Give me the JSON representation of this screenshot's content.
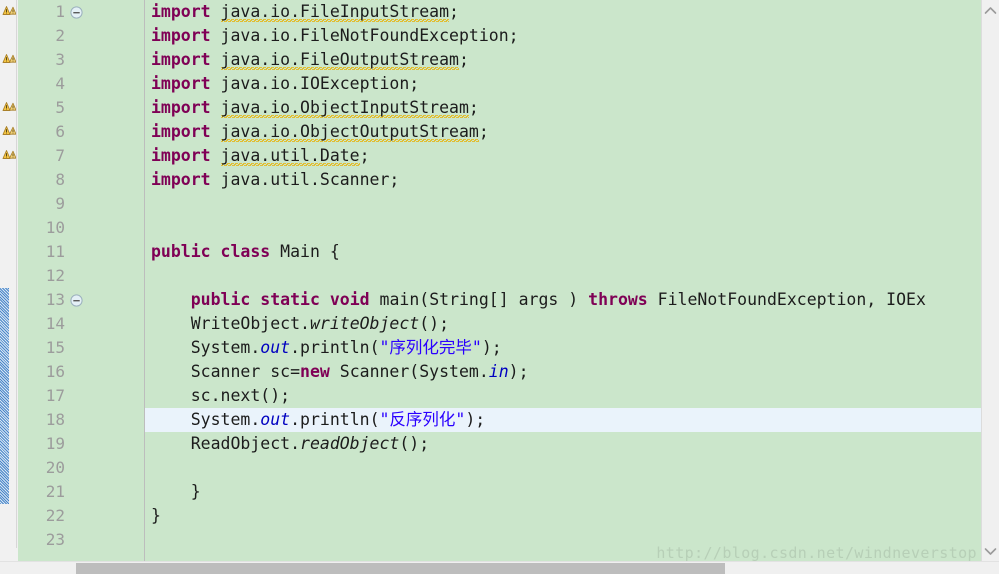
{
  "editor": {
    "language": "java",
    "theme": {
      "background": "#cbe6cb",
      "gutter_background": "#cbe6cb",
      "annotation_ruler_background": "#f1f1f1",
      "line_number_color": "#9c9c9c",
      "keyword_color": "#7f0055",
      "string_color": "#2a00ff",
      "field_color": "#0000c0",
      "text_color": "#1c1c1c",
      "current_line_highlight": "#eaf3fb",
      "warning_squiggle_color": "#e8b000",
      "change_bar_color": "#4a86c8",
      "scrollbar_thumb": "#bdbdbd"
    },
    "current_line": 18,
    "change_bar_start_line": 13,
    "change_bar_end_line": 21,
    "fold_marker_lines": [
      1,
      13
    ],
    "warning_icon_lines": [
      1,
      3,
      5,
      6,
      7
    ],
    "lines": [
      {
        "n": 1,
        "tokens": [
          {
            "t": "import",
            "c": "kw"
          },
          {
            "t": " ",
            "c": "plain"
          },
          {
            "t": "java.io.FileInputStream",
            "c": "plain warnsq"
          },
          {
            "t": ";",
            "c": "plain"
          }
        ]
      },
      {
        "n": 2,
        "tokens": [
          {
            "t": "import",
            "c": "kw"
          },
          {
            "t": " ",
            "c": "plain"
          },
          {
            "t": "java.io.FileNotFoundException;",
            "c": "plain"
          }
        ]
      },
      {
        "n": 3,
        "tokens": [
          {
            "t": "import",
            "c": "kw"
          },
          {
            "t": " ",
            "c": "plain"
          },
          {
            "t": "java.io.FileOutputStream",
            "c": "plain warnsq"
          },
          {
            "t": ";",
            "c": "plain"
          }
        ]
      },
      {
        "n": 4,
        "tokens": [
          {
            "t": "import",
            "c": "kw"
          },
          {
            "t": " ",
            "c": "plain"
          },
          {
            "t": "java.io.IOException;",
            "c": "plain"
          }
        ]
      },
      {
        "n": 5,
        "tokens": [
          {
            "t": "import",
            "c": "kw"
          },
          {
            "t": " ",
            "c": "plain"
          },
          {
            "t": "java.io.ObjectInputStream",
            "c": "plain warnsq"
          },
          {
            "t": ";",
            "c": "plain"
          }
        ]
      },
      {
        "n": 6,
        "tokens": [
          {
            "t": "import",
            "c": "kw"
          },
          {
            "t": " ",
            "c": "plain"
          },
          {
            "t": "java.io.ObjectOutputStream",
            "c": "plain warnsq"
          },
          {
            "t": ";",
            "c": "plain"
          }
        ]
      },
      {
        "n": 7,
        "tokens": [
          {
            "t": "import",
            "c": "kw"
          },
          {
            "t": " ",
            "c": "plain"
          },
          {
            "t": "java.util.Date",
            "c": "plain warnsq"
          },
          {
            "t": ";",
            "c": "plain"
          }
        ]
      },
      {
        "n": 8,
        "tokens": [
          {
            "t": "import",
            "c": "kw"
          },
          {
            "t": " ",
            "c": "plain"
          },
          {
            "t": "java.util.Scanner;",
            "c": "plain"
          }
        ]
      },
      {
        "n": 9,
        "tokens": []
      },
      {
        "n": 10,
        "tokens": []
      },
      {
        "n": 11,
        "tokens": [
          {
            "t": "public",
            "c": "kw"
          },
          {
            "t": " ",
            "c": "plain"
          },
          {
            "t": "class",
            "c": "kw"
          },
          {
            "t": " Main {",
            "c": "plain"
          }
        ]
      },
      {
        "n": 12,
        "tokens": []
      },
      {
        "n": 13,
        "tokens": [
          {
            "t": "    ",
            "c": "plain"
          },
          {
            "t": "public",
            "c": "kw"
          },
          {
            "t": " ",
            "c": "plain"
          },
          {
            "t": "static",
            "c": "kw"
          },
          {
            "t": " ",
            "c": "plain"
          },
          {
            "t": "void",
            "c": "kw"
          },
          {
            "t": " main(String[] args ) ",
            "c": "plain"
          },
          {
            "t": "throws",
            "c": "kw"
          },
          {
            "t": " FileNotFoundException, IOEx",
            "c": "plain"
          }
        ]
      },
      {
        "n": 14,
        "tokens": [
          {
            "t": "    WriteObject.",
            "c": "plain"
          },
          {
            "t": "writeObject",
            "c": "mth"
          },
          {
            "t": "();",
            "c": "plain"
          }
        ]
      },
      {
        "n": 15,
        "tokens": [
          {
            "t": "    System.",
            "c": "plain"
          },
          {
            "t": "out",
            "c": "fld"
          },
          {
            "t": ".println(",
            "c": "plain"
          },
          {
            "t": "\"序列化完毕\"",
            "c": "str"
          },
          {
            "t": ");",
            "c": "plain"
          }
        ]
      },
      {
        "n": 16,
        "tokens": [
          {
            "t": "    Scanner sc=",
            "c": "plain"
          },
          {
            "t": "new",
            "c": "kw"
          },
          {
            "t": " Scanner(System.",
            "c": "plain"
          },
          {
            "t": "in",
            "c": "fld"
          },
          {
            "t": ");",
            "c": "plain"
          }
        ]
      },
      {
        "n": 17,
        "tokens": [
          {
            "t": "    sc.next();",
            "c": "plain"
          }
        ]
      },
      {
        "n": 18,
        "tokens": [
          {
            "t": "    System.",
            "c": "plain"
          },
          {
            "t": "out",
            "c": "fld"
          },
          {
            "t": ".println(",
            "c": "plain"
          },
          {
            "t": "\"反序列化\"",
            "c": "str"
          },
          {
            "t": ");",
            "c": "plain"
          }
        ]
      },
      {
        "n": 19,
        "tokens": [
          {
            "t": "    ReadObject.",
            "c": "plain"
          },
          {
            "t": "readObject",
            "c": "mth"
          },
          {
            "t": "();",
            "c": "plain"
          }
        ]
      },
      {
        "n": 20,
        "tokens": []
      },
      {
        "n": 21,
        "tokens": [
          {
            "t": "    }",
            "c": "plain"
          }
        ]
      },
      {
        "n": 22,
        "tokens": [
          {
            "t": "}",
            "c": "plain"
          }
        ]
      },
      {
        "n": 23,
        "tokens": []
      }
    ]
  },
  "watermark": {
    "text": "http://blog.csdn.net/windneverstop"
  },
  "scrollbars": {
    "vertical": {
      "up_arrow": "chevron-up-icon",
      "down_arrow": "chevron-down-icon"
    },
    "horizontal": {
      "thumb_left_pct": 7.6,
      "thumb_width_pct": 65
    }
  }
}
